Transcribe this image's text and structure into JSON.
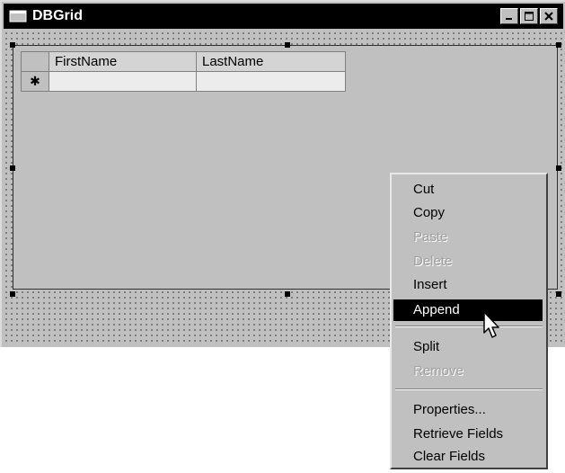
{
  "window": {
    "title": "DBGrid"
  },
  "grid": {
    "columns": [
      "FirstName",
      "LastName"
    ],
    "new_row_indicator": "✱"
  },
  "context_menu": {
    "items": [
      {
        "label": "Cut",
        "enabled": true
      },
      {
        "label": "Copy",
        "enabled": true
      },
      {
        "label": "Paste",
        "enabled": false
      },
      {
        "label": "Delete",
        "enabled": false
      },
      {
        "label": "Insert",
        "enabled": true
      },
      {
        "label": "Append",
        "enabled": true,
        "selected": true
      },
      {
        "label": "Split",
        "enabled": true
      },
      {
        "label": "Remove",
        "enabled": false
      },
      {
        "label": "Properties...",
        "enabled": true
      },
      {
        "label": "Retrieve Fields",
        "enabled": true
      },
      {
        "label": "Clear Fields",
        "enabled": true
      }
    ]
  },
  "colors": {
    "titlebar": "#000000",
    "face": "#c0c0c0",
    "selection": "#000000",
    "disabled_text": "#a0a0a0"
  }
}
